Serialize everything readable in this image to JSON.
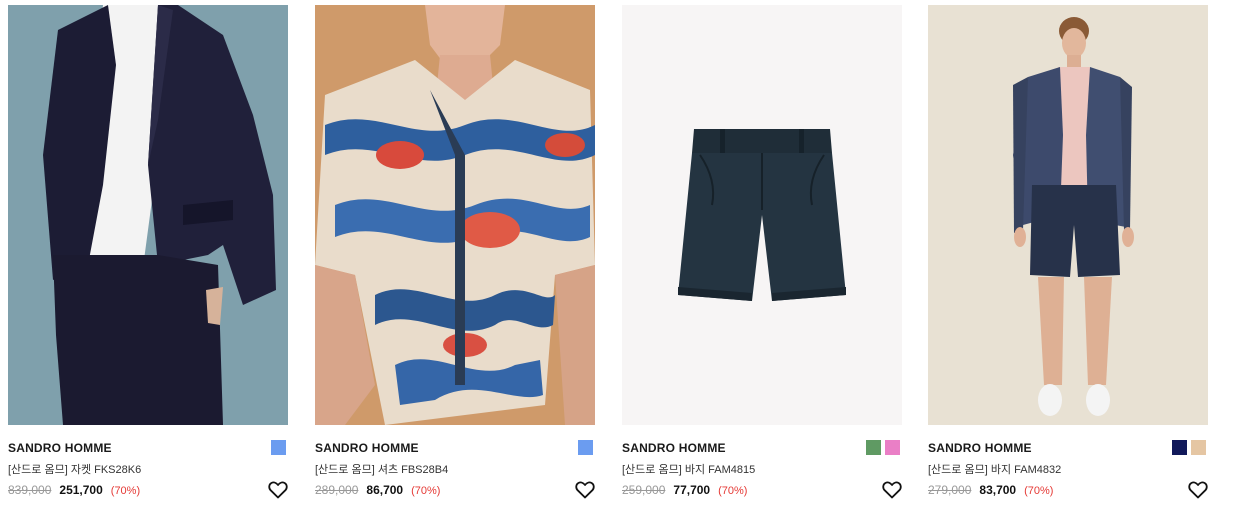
{
  "products": [
    {
      "brand": "SANDRO HOMME",
      "name": "[산드로 옴므] 자켓 FKS28K6",
      "original_price": "839,000",
      "sale_price": "251,700",
      "discount": "(70%)",
      "swatches": [
        "#6b9cf0"
      ],
      "image": "man-in-navy-suit-photo"
    },
    {
      "brand": "SANDRO HOMME",
      "name": "[산드로 옴므] 셔츠 FBS28B4",
      "original_price": "289,000",
      "sale_price": "86,700",
      "discount": "(70%)",
      "swatches": [
        "#6b9cf0"
      ],
      "image": "man-in-goldfish-print-shirt-photo"
    },
    {
      "brand": "SANDRO HOMME",
      "name": "[산드로 옴므] 바지 FAM4815",
      "original_price": "259,000",
      "sale_price": "77,700",
      "discount": "(70%)",
      "swatches": [
        "#5f9a63",
        "#ea7fc6"
      ],
      "image": "navy-shorts-product-photo"
    },
    {
      "brand": "SANDRO HOMME",
      "name": "[산드로 옴므] 바지 FAM4832",
      "original_price": "279,000",
      "sale_price": "83,700",
      "discount": "(70%)",
      "swatches": [
        "#11195a",
        "#e5c6a3"
      ],
      "image": "man-in-blazer-and-shorts-photo"
    }
  ],
  "icons": {
    "wishlist": "heart-outline-icon"
  }
}
